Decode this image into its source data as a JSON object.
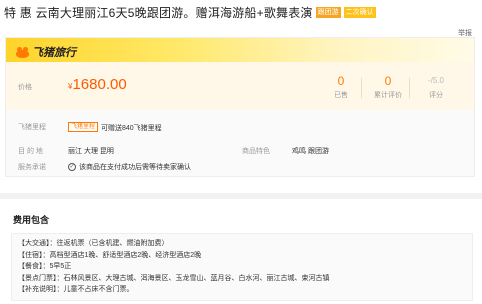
{
  "header": {
    "title": "特 惠 云南大理丽江6天5晚跟团游。赠洱海游船+歌舞表演",
    "tags": [
      "跟团游",
      "二次确认"
    ],
    "report_label": "举报"
  },
  "brand": {
    "name": "飞猪旅行",
    "accent_color": "#ffd42a",
    "logo_color": "#ff7a00"
  },
  "price": {
    "label": "价格",
    "currency": "¥",
    "amount": "1680.00",
    "color": "#ff5a00"
  },
  "stats": [
    {
      "value": "0",
      "label": "已售"
    },
    {
      "value": "0",
      "label": "累计评价"
    },
    {
      "value": "-/5.0",
      "label": "评分"
    }
  ],
  "mileage": {
    "label": "飞猪里程",
    "badge": "飞猪里程",
    "text": "可赠送840飞猪里程"
  },
  "destination": {
    "label": "目 的 地",
    "value": "丽江  大理  昆明",
    "feature_label": "商品特色",
    "feature_value": "鸡鸣  跟团游"
  },
  "service": {
    "label": "服务承诺",
    "icon": "check-circle-icon",
    "text": "该商品在支付成功后需等待卖家确认"
  },
  "fees": {
    "title": "费用包含",
    "lines": [
      "【大交通】：往返机票（已含机建、燃油附加费）",
      "【住宿】：高档型酒店1晚、舒适型酒店2晚、经济型酒店2晚",
      "【餐食】：5早5正",
      "【景点门票】：石林风景区、大理古城、洱海景区、玉龙雪山、蓝月谷、白水河、丽江古城、束河古镇",
      "【补充说明】：儿童不占床不含门票。"
    ]
  }
}
